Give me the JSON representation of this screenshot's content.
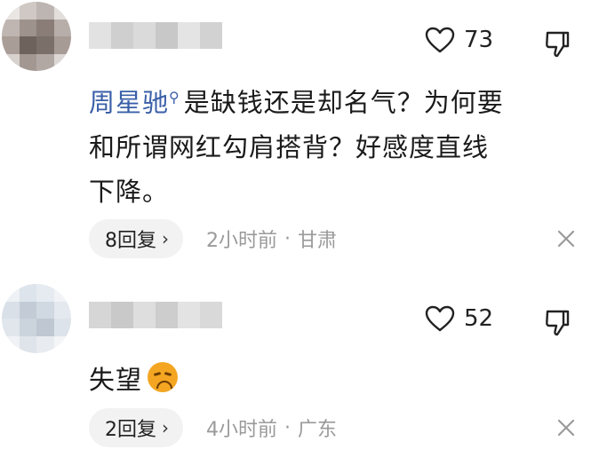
{
  "comments": [
    {
      "likes": "73",
      "mention": "周星驰",
      "text_line1": "是缺钱还是却名气？为何要",
      "text_line2": "和所谓网红勾肩搭背？好感度直线",
      "text_line3": "下降。",
      "reply_label": "8回复",
      "reply_chevron": "›",
      "time": "2小时前",
      "separator": "·",
      "region": "甘肃"
    },
    {
      "likes": "52",
      "text": "失望",
      "emoji": "disappointed-face",
      "reply_label": "2回复",
      "reply_chevron": "›",
      "time": "4小时前",
      "separator": "·",
      "region": "广东"
    }
  ],
  "icons": {
    "like": "heart-outline-icon",
    "dislike": "thumbs-down-icon",
    "close": "close-icon",
    "mention_search": "search-icon"
  },
  "colors": {
    "mention": "#3a5fa8",
    "meta_text": "#9a9a9a",
    "reply_pill_bg": "#f2f2f2"
  }
}
